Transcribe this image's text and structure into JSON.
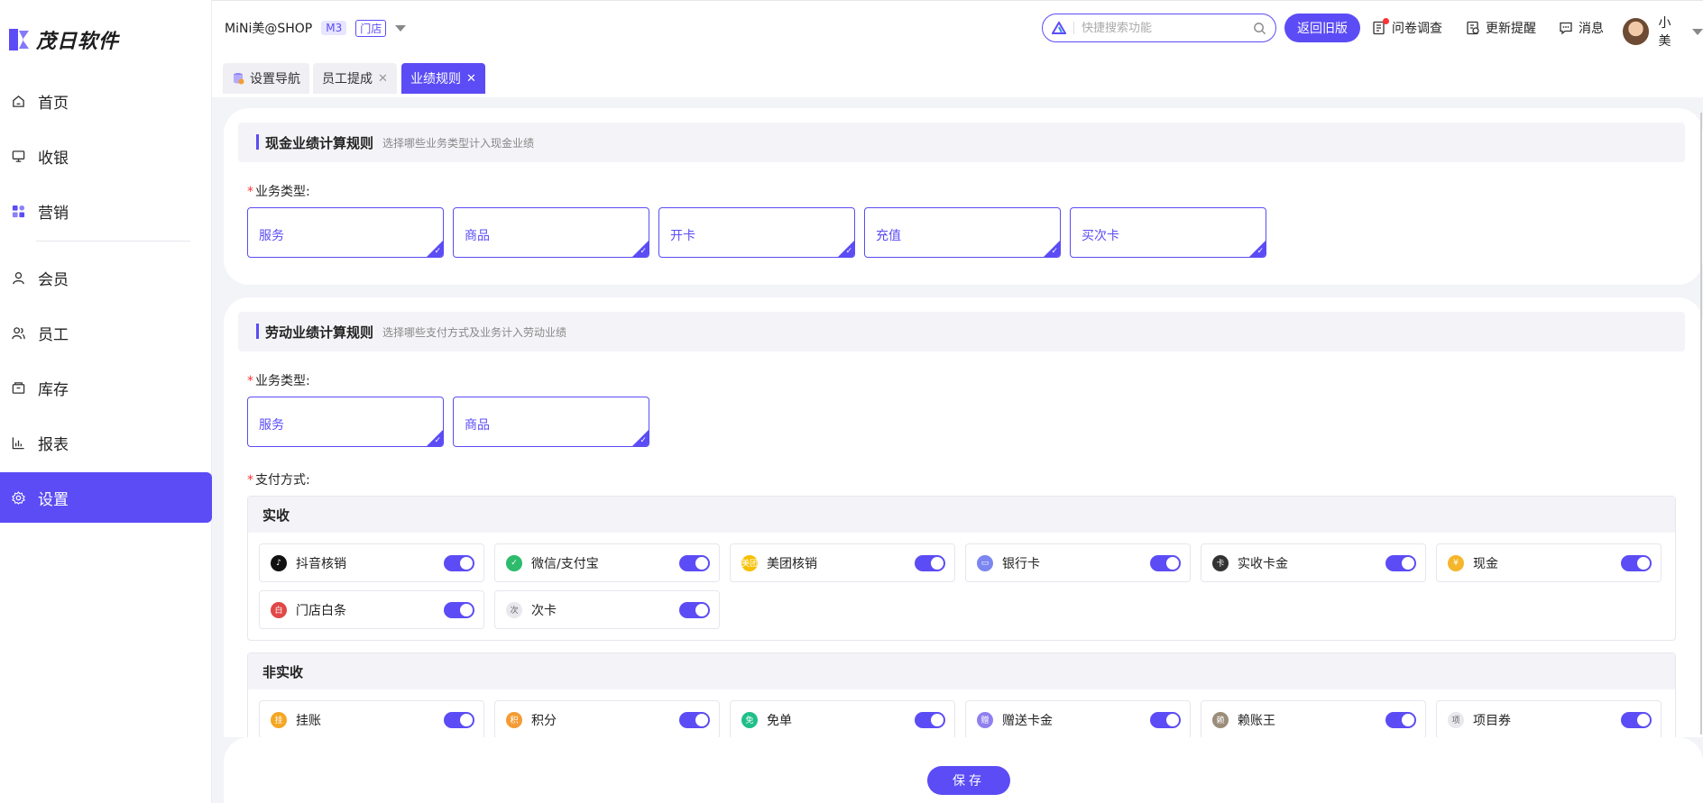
{
  "app": {
    "brand": "茂日软件"
  },
  "sidebar": {
    "items": [
      {
        "label": "首页",
        "icon": "home-icon"
      },
      {
        "label": "收银",
        "icon": "cashier-icon"
      },
      {
        "label": "营销",
        "icon": "marketing-icon"
      },
      {
        "label": "会员",
        "icon": "member-icon"
      },
      {
        "label": "员工",
        "icon": "staff-icon"
      },
      {
        "label": "库存",
        "icon": "inventory-icon"
      },
      {
        "label": "报表",
        "icon": "report-icon"
      },
      {
        "label": "设置",
        "icon": "settings-icon",
        "active": true
      }
    ]
  },
  "header": {
    "shop_name": "MiNi美@SHOP",
    "version_badge": "M3",
    "store_badge": "门店",
    "search_placeholder": "快捷搜索功能",
    "old_version_label": "返回旧版",
    "survey_label": "问卷调查",
    "update_label": "更新提醒",
    "message_label": "消息",
    "user_name": "小美"
  },
  "tabs": [
    {
      "label": "设置导航",
      "closable": false
    },
    {
      "label": "员工提成",
      "closable": true
    },
    {
      "label": "业绩规则",
      "closable": true,
      "active": true
    }
  ],
  "cash_section": {
    "title": "现金业绩计算规则",
    "subtitle": "选择哪些业务类型计入现金业绩",
    "field_label": "业务类型:",
    "types": [
      "服务",
      "商品",
      "开卡",
      "充值",
      "买次卡"
    ]
  },
  "labor_section": {
    "title": "劳动业绩计算规则",
    "subtitle": "选择哪些支付方式及业务计入劳动业绩",
    "field_label": "业务类型:",
    "types": [
      "服务",
      "商品"
    ],
    "pay_label": "支付方式:",
    "groups": [
      {
        "title": "实收",
        "items": [
          {
            "name": "抖音核销",
            "icon_text": "♪",
            "color": "#111111"
          },
          {
            "name": "微信/支付宝",
            "icon_text": "✓",
            "color": "#2dbb6c"
          },
          {
            "name": "美团核销",
            "icon_text": "美团",
            "color": "#f6c000"
          },
          {
            "name": "银行卡",
            "icon_text": "▭",
            "color": "#7b86f0"
          },
          {
            "name": "实收卡金",
            "icon_text": "卡",
            "color": "#333333"
          },
          {
            "name": "现金",
            "icon_text": "¥",
            "color": "#f5b62c"
          },
          {
            "name": "门店白条",
            "icon_text": "白",
            "color": "#e04848"
          },
          {
            "name": "次卡",
            "icon_text": "次",
            "color": "#e8e8ee"
          }
        ]
      },
      {
        "title": "非实收",
        "items": [
          {
            "name": "挂账",
            "icon_text": "挂",
            "color": "#f5a623"
          },
          {
            "name": "积分",
            "icon_text": "积",
            "color": "#f39c34"
          },
          {
            "name": "免单",
            "icon_text": "免",
            "color": "#1fbf8a"
          },
          {
            "name": "赠送卡金",
            "icon_text": "赠",
            "color": "#8f7ff0"
          },
          {
            "name": "赖账王",
            "icon_text": "赖",
            "color": "#9b8d7a"
          },
          {
            "name": "项目券",
            "icon_text": "项",
            "color": "#e8e8ee"
          }
        ]
      }
    ]
  },
  "footer": {
    "save_label": "保存"
  },
  "colors": {
    "accent": "#5b4cf5",
    "required": "#ff3333"
  }
}
